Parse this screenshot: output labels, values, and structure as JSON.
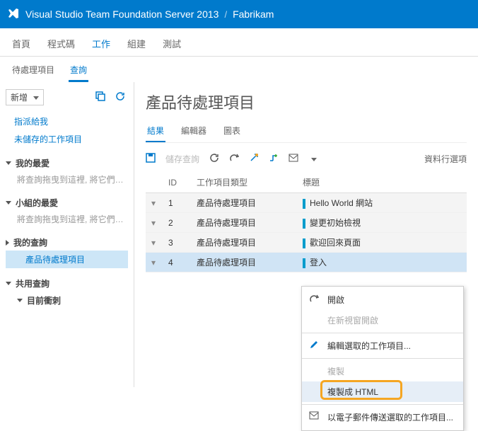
{
  "header": {
    "title": "Visual Studio Team Foundation Server 2013",
    "project": "Fabrikam"
  },
  "tabs": [
    "首頁",
    "程式碼",
    "工作",
    "組建",
    "測試"
  ],
  "active_tab": 2,
  "subtabs": [
    "待處理項目",
    "查詢"
  ],
  "active_subtab": 1,
  "sidebar": {
    "add_label": "新增",
    "links": [
      "指派給我",
      "未儲存的工作項目"
    ],
    "sections": {
      "favorites": {
        "label": "我的最愛",
        "hint": "將查詢拖曳到這裡, 將它們加入..."
      },
      "team_fav": {
        "label": "小組的最愛",
        "hint": "將查詢拖曳到這裡, 將它們加入..."
      },
      "my_queries": {
        "label": "我的查詢",
        "selected": "產品待處理項目"
      },
      "shared": {
        "label": "共用查詢",
        "child": "目前衝刺"
      }
    }
  },
  "main": {
    "title": "產品待處理項目",
    "view_tabs": [
      "結果",
      "編輯器",
      "圖表"
    ],
    "active_view": 0,
    "toolbar": {
      "save": "儲存查詢",
      "col_options": "資料行選項"
    },
    "columns": [
      "",
      "ID",
      "工作項目類型",
      "標題"
    ],
    "rows": [
      {
        "id": 1,
        "type": "產品待處理項目",
        "title": "Hello World 網站"
      },
      {
        "id": 2,
        "type": "產品待處理項目",
        "title": "變更初始檢視"
      },
      {
        "id": 3,
        "type": "產品待處理項目",
        "title": "歡迎回來頁面"
      },
      {
        "id": 4,
        "type": "產品待處理項目",
        "title": "登入"
      }
    ],
    "selected_row": 3
  },
  "context_menu": {
    "open": "開啟",
    "open_new": "在新視窗開啟",
    "edit_selected": "編輯選取的工作項目...",
    "copy": "複製",
    "copy_html": "複製成 HTML",
    "email": "以電子郵件傳送選取的工作項目..."
  }
}
